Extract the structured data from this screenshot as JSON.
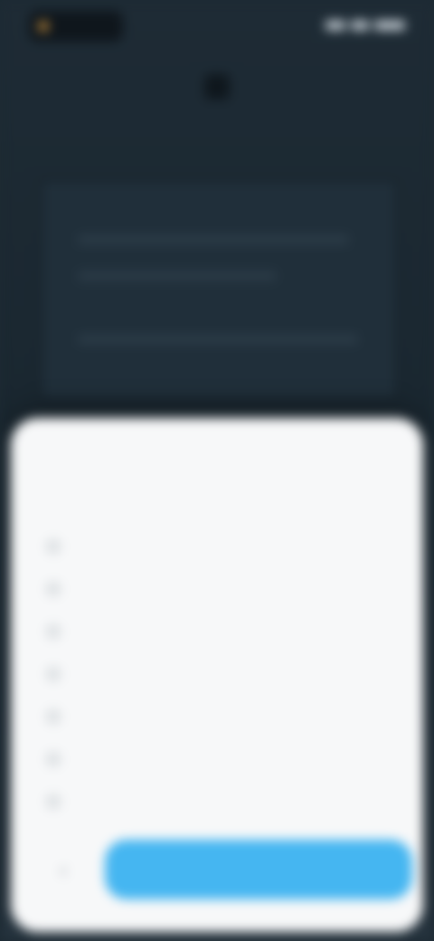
{
  "status": {
    "logo_icon": "app-logo-icon",
    "indicators": [
      "signal-icon",
      "wifi-icon",
      "battery-icon"
    ]
  },
  "background": {
    "hero_icon": "app-icon"
  },
  "sheet": {
    "title": "",
    "options": [
      {
        "label": ""
      },
      {
        "label": ""
      },
      {
        "label": ""
      },
      {
        "label": ""
      },
      {
        "label": ""
      },
      {
        "label": ""
      },
      {
        "label": ""
      }
    ],
    "back_icon": "chevron-left-icon",
    "primary_button": {
      "label": "",
      "color": "#45b6f1"
    }
  },
  "colors": {
    "background": "#1d2a33",
    "sheet": "#f7f8f9",
    "accent": "#45b6f1"
  }
}
